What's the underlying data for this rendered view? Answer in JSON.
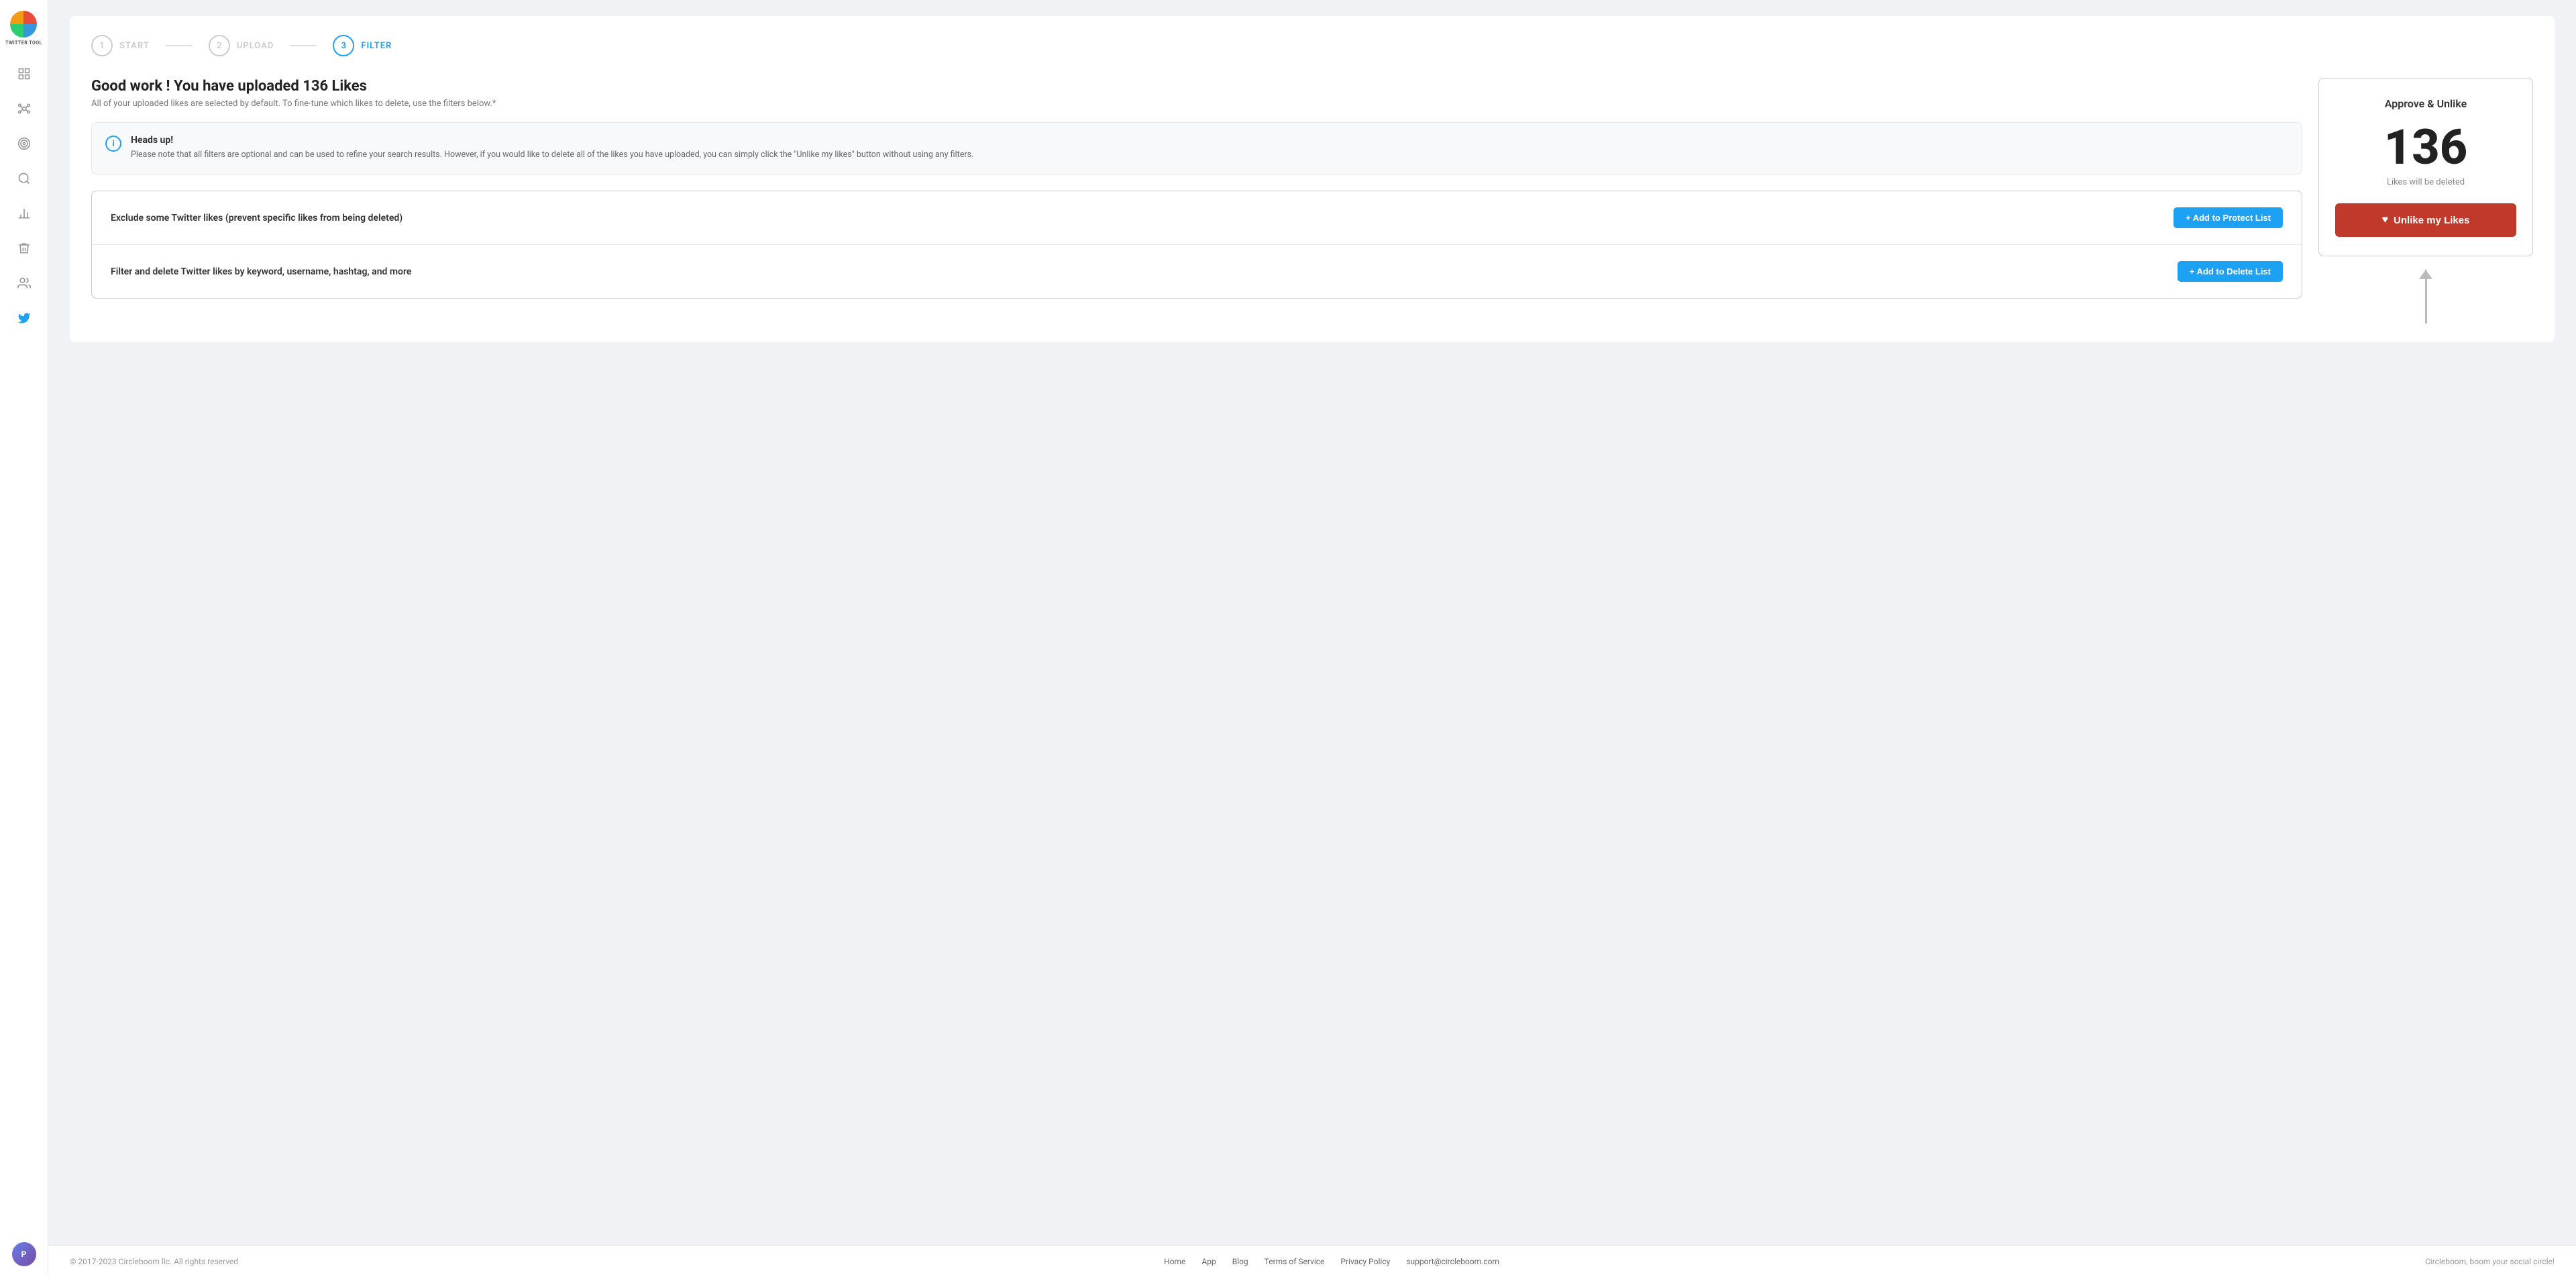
{
  "sidebar": {
    "logo_text": "TWITTER TOOL",
    "items": [
      {
        "name": "dashboard",
        "label": "Dashboard",
        "active": false
      },
      {
        "name": "network",
        "label": "Network",
        "active": false
      },
      {
        "name": "target",
        "label": "Target",
        "active": false
      },
      {
        "name": "search",
        "label": "Search",
        "active": false
      },
      {
        "name": "analytics",
        "label": "Analytics",
        "active": false
      },
      {
        "name": "delete",
        "label": "Delete",
        "active": false
      },
      {
        "name": "audience",
        "label": "Audience",
        "active": false
      },
      {
        "name": "twitter",
        "label": "Twitter",
        "active": true
      }
    ],
    "avatar_initial": "P"
  },
  "stepper": {
    "steps": [
      {
        "number": "1",
        "label": "START",
        "active": false
      },
      {
        "number": "2",
        "label": "UPLOAD",
        "active": false
      },
      {
        "number": "3",
        "label": "FILTER",
        "active": true
      }
    ]
  },
  "main": {
    "title": "Good work ! You have uploaded 136 Likes",
    "subtitle": "All of your uploaded likes are selected by default. To fine-tune which likes to delete, use the filters below.*",
    "info_box": {
      "title": "Heads up!",
      "text": "Please note that all filters are optional and can be used to refine your search results. However, if you would like to delete all of the likes you have uploaded, you can simply click the \"Unlike my likes\" button without using any filters."
    },
    "filters": [
      {
        "label": "Exclude some Twitter likes (prevent specific likes from being deleted)",
        "button": "+ Add to Protect List"
      },
      {
        "label": "Filter and delete Twitter likes by keyword, username, hashtag, and more",
        "button": "+ Add to Delete List"
      }
    ]
  },
  "approve_card": {
    "title": "Approve & Unlike",
    "count": "136",
    "subtitle": "Likes will be deleted",
    "button_label": "Unlike my Likes"
  },
  "footer": {
    "copyright": "© 2017-2023 Circleboom llc. All rights reserved",
    "links": [
      {
        "label": "Home"
      },
      {
        "label": "App"
      },
      {
        "label": "Blog"
      },
      {
        "label": "Terms of Service"
      },
      {
        "label": "Privacy Policy"
      },
      {
        "label": "support@circleboom.com"
      }
    ],
    "tagline": "Circleboom, boom your social circle!"
  }
}
